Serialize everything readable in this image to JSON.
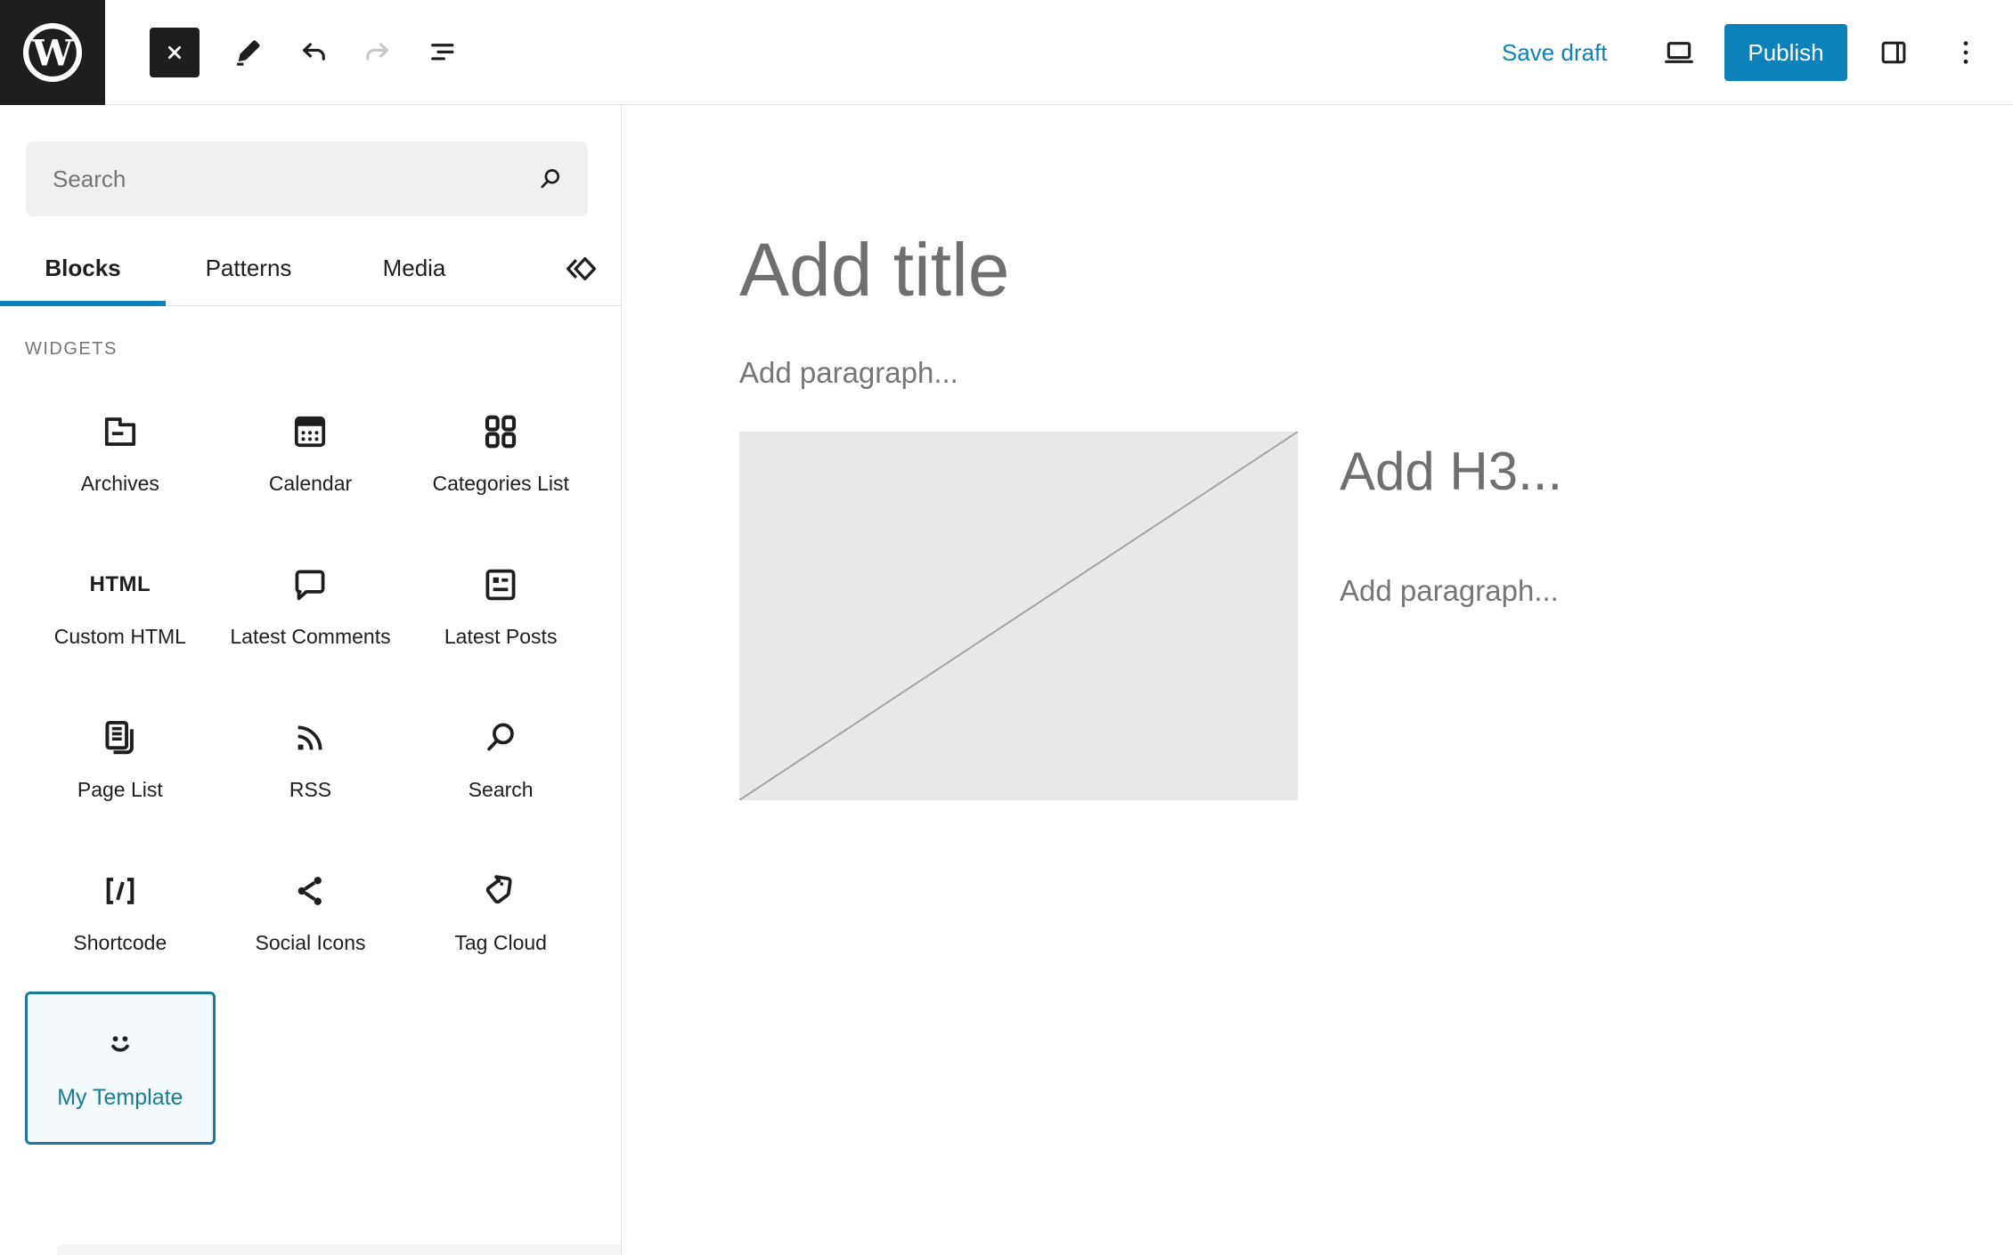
{
  "colors": {
    "accent": "#0d82ba",
    "accent_dark": "#1a7a99",
    "toolbar_dark": "#1e1e1e",
    "placeholder_gray": "#6f6f6f"
  },
  "topbar": {
    "save_draft_label": "Save draft",
    "publish_label": "Publish",
    "icons": [
      "wordpress-logo",
      "close-icon",
      "pencil-icon",
      "undo-icon",
      "redo-icon",
      "list-view-icon",
      "preview-laptop-icon",
      "settings-panel-icon",
      "more-options-icon"
    ]
  },
  "inserter": {
    "search_placeholder": "Search",
    "tabs": [
      {
        "label": "Blocks",
        "active": true
      },
      {
        "label": "Patterns",
        "active": false
      },
      {
        "label": "Media",
        "active": false
      }
    ],
    "tabs_extra_icon": "chevron-diamond-icon",
    "section_label": "WIDGETS",
    "html_icon_text": "HTML",
    "blocks": [
      {
        "label": "Archives",
        "icon": "archive-icon"
      },
      {
        "label": "Calendar",
        "icon": "calendar-icon"
      },
      {
        "label": "Categories List",
        "icon": "categories-icon"
      },
      {
        "label": "Custom HTML",
        "icon": "html-icon"
      },
      {
        "label": "Latest Comments",
        "icon": "comment-icon"
      },
      {
        "label": "Latest Posts",
        "icon": "latest-posts-icon"
      },
      {
        "label": "Page List",
        "icon": "page-list-icon"
      },
      {
        "label": "RSS",
        "icon": "rss-icon"
      },
      {
        "label": "Search",
        "icon": "search-icon"
      },
      {
        "label": "Shortcode",
        "icon": "shortcode-icon"
      },
      {
        "label": "Social Icons",
        "icon": "share-icon"
      },
      {
        "label": "Tag Cloud",
        "icon": "tag-icon"
      },
      {
        "label": "My Template",
        "icon": "smiley-icon",
        "custom": true
      }
    ]
  },
  "canvas": {
    "title_placeholder": "Add title",
    "paragraph_placeholder": "Add paragraph...",
    "h3_placeholder": "Add H3...",
    "paragraph2_placeholder": "Add paragraph...",
    "image_block": "empty-image-placeholder"
  }
}
